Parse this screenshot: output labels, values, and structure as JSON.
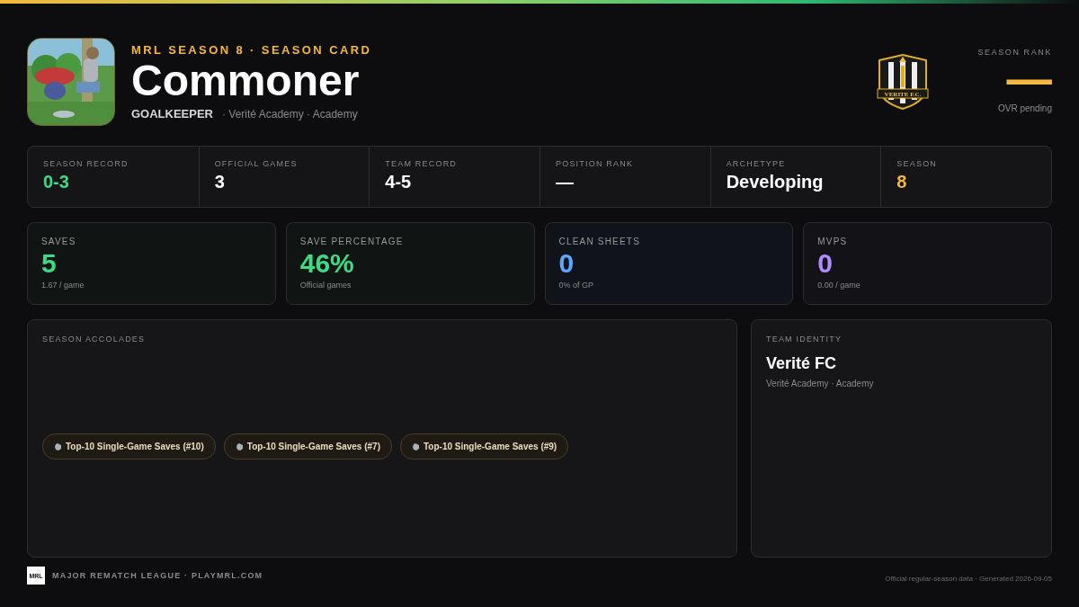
{
  "header": {
    "eyebrow": "MRL SEASON 8 · SEASON CARD",
    "player_name": "Commoner",
    "position": "GOALKEEPER",
    "affiliation": "· Verité Academy · Academy",
    "crest": {
      "label": "VERITE F.C."
    },
    "rank": {
      "label": "SEASON RANK",
      "value": "—",
      "note": "OVR pending"
    }
  },
  "record_strip": [
    {
      "label": "SEASON RECORD",
      "value": "0-3",
      "color": "#3ddc84"
    },
    {
      "label": "OFFICIAL GAMES",
      "value": "3",
      "color": "#ffffff"
    },
    {
      "label": "TEAM RECORD",
      "value": "4-5",
      "color": "#ffffff"
    },
    {
      "label": "POSITION RANK",
      "value": "—",
      "color": "#ffffff"
    },
    {
      "label": "ARCHETYPE",
      "value": "Developing",
      "color": "#ffffff"
    },
    {
      "label": "SEASON",
      "value": "8",
      "color": "#f5b83d"
    }
  ],
  "stat_cards": [
    {
      "label": "SAVES",
      "value": "5",
      "sub": "1.67 / game",
      "color": "#3ddc84"
    },
    {
      "label": "SAVE PERCENTAGE",
      "value": "46%",
      "sub": "Official games",
      "color": "#3ddc84"
    },
    {
      "label": "CLEAN SHEETS",
      "value": "0",
      "sub": "0% of GP",
      "color": "#5aa9ff"
    },
    {
      "label": "MVPS",
      "value": "0",
      "sub": "0.00 / game",
      "color": "#b08cff"
    }
  ],
  "accolades": {
    "title": "SEASON ACCOLADES",
    "items": [
      "Top-10 Single-Game Saves (#10)",
      "Top-10 Single-Game Saves (#7)",
      "Top-10 Single-Game Saves (#9)"
    ]
  },
  "team_identity": {
    "title": "TEAM IDENTITY",
    "team": "Verité FC",
    "sub": "Verité Academy · Academy"
  },
  "footer": {
    "logo": "MRL",
    "league": "MAJOR REMATCH LEAGUE · PLAYMRL.COM",
    "note": "Official regular-season data · Generated 2026-09-05"
  }
}
